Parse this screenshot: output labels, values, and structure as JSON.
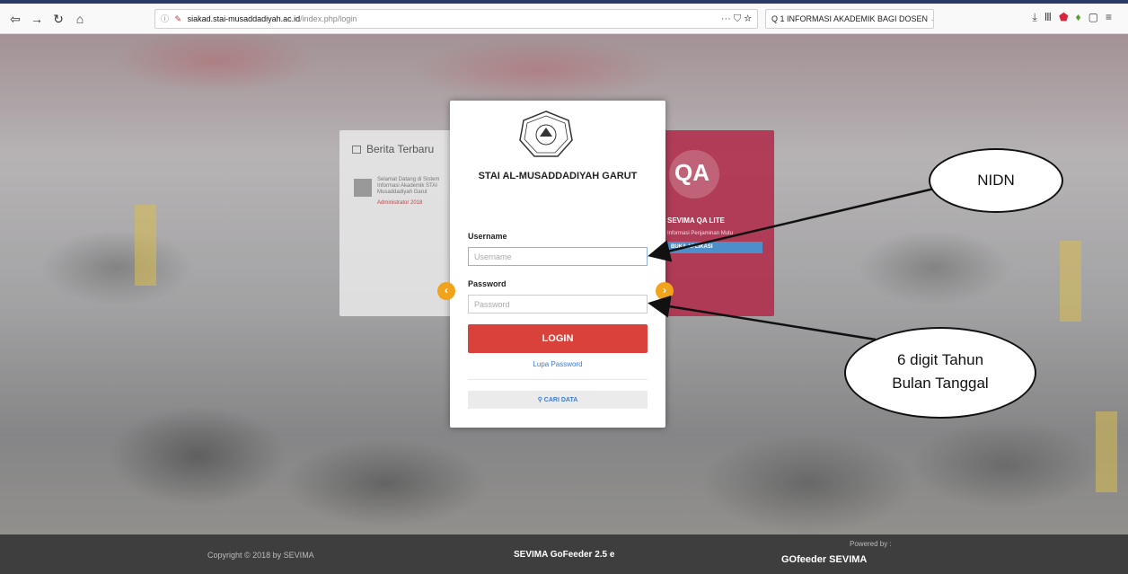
{
  "browser": {
    "url_info": "ⓘ",
    "url_domain": "siakad.stai-musaddadiyah.ac.id",
    "url_rest": "/index.php/login",
    "url_prefix": "siakad.",
    "url_actions": "··· ⛉ ☆",
    "search_text": "Q 1 INFORMASI AKADEMIK BAGI DOSEN →"
  },
  "news_card": {
    "title": "Berita Terbaru",
    "item_text": "Selamat Datang di Sistem Informasi Akademik STAI Musaddadiyah Garut",
    "item_meta": "Administrator 2018"
  },
  "qa_card": {
    "title": "SEVIMA QA LITE",
    "subtitle": "Informasi Penjaminan Mutu",
    "button": "BUKA APLIKASI"
  },
  "login": {
    "school_name": "STAI AL-MUSADDADIYAH GARUT",
    "username_label": "Username",
    "username_placeholder": "Username",
    "password_label": "Password",
    "password_placeholder": "Password",
    "login_button": "LOGIN",
    "forgot_link": "Lupa Password",
    "search_button": "CARI DATA"
  },
  "footer": {
    "copyright": "Copyright © 2018 by SEVIMA",
    "product": "SEVIMA GoFeeder 2.5 e",
    "powered_by": "Powered by :",
    "brand": "GOfeeder SEVIMA"
  },
  "annotations": {
    "nidn": "NIDN",
    "password_hint_line1": "6 digit Tahun",
    "password_hint_line2": "Bulan Tanggal"
  }
}
